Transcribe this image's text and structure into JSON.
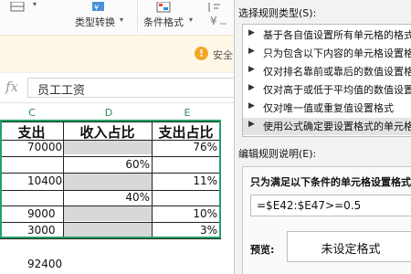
{
  "toolbar": {
    "type_convert_label": "类型转换",
    "conditional_format_label": "条件格式"
  },
  "notice": {
    "text": "安全"
  },
  "formula_bar": {
    "fx": "fx",
    "content": "员工工资"
  },
  "sheet": {
    "columns": [
      "C",
      "D",
      "E"
    ],
    "header_row": [
      "支出",
      "收入占比",
      "支出占比"
    ],
    "rows": [
      {
        "c": "70000",
        "d": "",
        "e": "76%",
        "gray_d": true
      },
      {
        "c": "",
        "d": "60%",
        "e": "",
        "gray_d": false
      },
      {
        "c": "10400",
        "d": "",
        "e": "11%",
        "gray_d": true
      },
      {
        "c": "",
        "d": "40%",
        "e": "",
        "gray_d": false
      },
      {
        "c": "9000",
        "d": "",
        "e": "10%",
        "gray_d": true
      },
      {
        "c": "3000",
        "d": "",
        "e": "3%",
        "gray_d": true
      }
    ],
    "bottom_value": "92400",
    "colors": {
      "selection": "#21a366",
      "gray_fill": "#d8d8d8"
    }
  },
  "dialog": {
    "select_rule_type_label": "选择规则类型(S):",
    "rule_types": [
      "基于各自值设置所有单元格的格式",
      "只为包含以下内容的单元格设置格式",
      "仅对排名靠前或靠后的数值设置格式",
      "仅对高于或低于平均值的数值设置格式",
      "仅对唯一值或重复值设置格式",
      "使用公式确定要设置格式的单元格"
    ],
    "selected_rule_index": 5,
    "edit_desc_label": "编辑规则说明(E):",
    "condition_title": "只为满足以下条件的单元格设置格式",
    "formula_value": "=$E42:$E47>=0.5",
    "preview_label": "预览:",
    "preview_text": "未设定格式"
  }
}
